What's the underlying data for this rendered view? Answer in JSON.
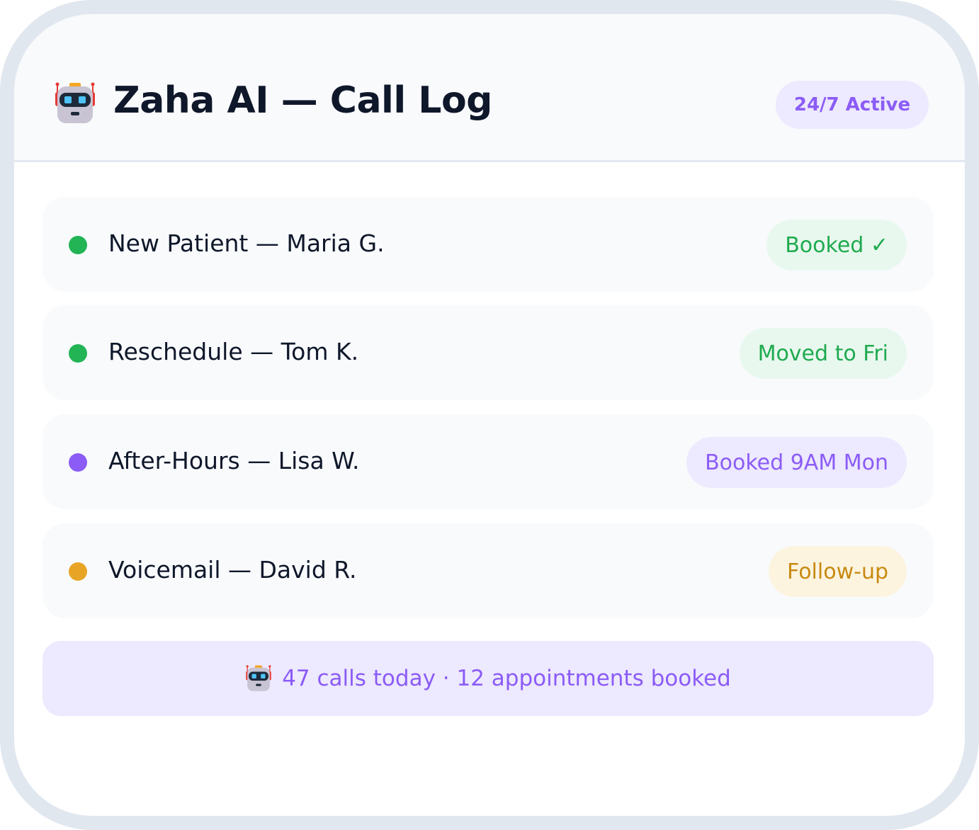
{
  "header": {
    "title": "Zaha AI — Call Log",
    "status_pill": "24/7 Active",
    "logo_icon": "robot-icon"
  },
  "calls": [
    {
      "label": "New Patient — Maria G.",
      "status": "Booked ✓",
      "dot_color": "#22b455",
      "badge_bg": "#e8f8ee",
      "badge_color": "#1faa4f"
    },
    {
      "label": "Reschedule — Tom K.",
      "status": "Moved to Fri",
      "dot_color": "#22b455",
      "badge_bg": "#e8f8ee",
      "badge_color": "#1faa4f"
    },
    {
      "label": "After-Hours — Lisa W.",
      "status": "Booked 9AM Mon",
      "dot_color": "#8b5cf6",
      "badge_bg": "#ede9fe",
      "badge_color": "#8b5cf6"
    },
    {
      "label": "Voicemail — David R.",
      "status": "Follow-up",
      "dot_color": "#e8a525",
      "badge_bg": "#fdf4e0",
      "badge_color": "#c78a10"
    }
  ],
  "footer": {
    "summary": "47 calls today · 12 appointments booked",
    "icon": "robot-icon"
  },
  "colors": {
    "accent": "#8b5cf6",
    "frame_border": "#e1e7ef",
    "text_dark": "#0f172a"
  }
}
